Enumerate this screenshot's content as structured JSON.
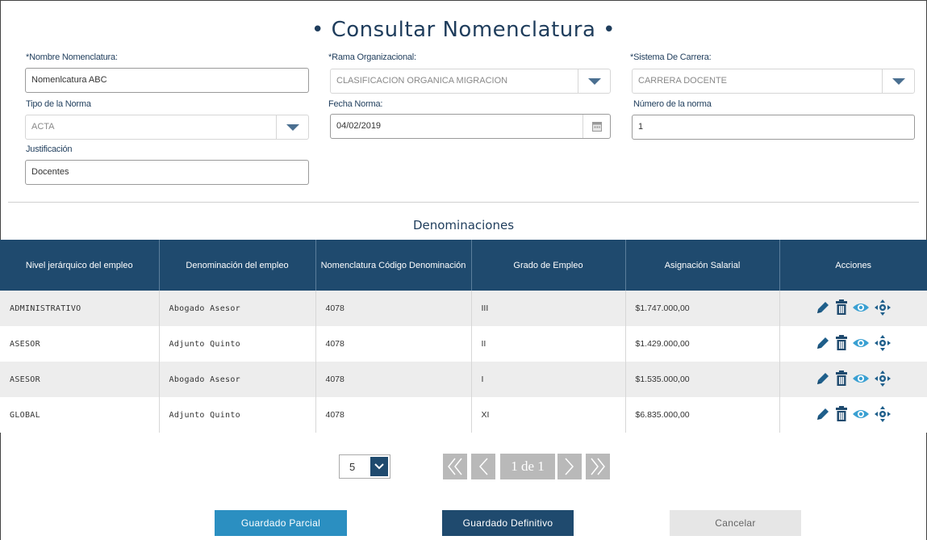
{
  "page": {
    "title": "• Consultar Nomenclatura •"
  },
  "form": {
    "nombre": {
      "label": "*Nombre Nomenclatura:",
      "value": "Nomenlcatura ABC"
    },
    "rama": {
      "label": "*Rama Organizacional:",
      "value": "CLASIFICACION ORGANICA MIGRACION"
    },
    "sistema": {
      "label": "*Sistema De Carrera:",
      "value": "CARRERA DOCENTE"
    },
    "tipo": {
      "label": "Tipo de la Norma",
      "value": "ACTA"
    },
    "fecha": {
      "label": "Fecha Norma:",
      "value": "04/02/2019"
    },
    "numero": {
      "label": "Número de la norma",
      "value": "1"
    },
    "justificacion": {
      "label": "Justificación",
      "value": "Docentes"
    }
  },
  "section": {
    "title": "Denominaciones"
  },
  "table": {
    "headers": [
      "Nivel jerárquico del empleo",
      "Denominación del empleo",
      "Nomenclatura Código Denominación",
      "Grado de Empleo",
      "Asignación Salarial",
      "Acciones"
    ],
    "rows": [
      {
        "nivel": "ADMINISTRATIVO",
        "denominacion": "Abogado Asesor",
        "codigo": "4078",
        "grado": "III",
        "salario": "$1.747.000,00"
      },
      {
        "nivel": "ASESOR",
        "denominacion": "Adjunto Quinto",
        "codigo": "4078",
        "grado": "II",
        "salario": "$1.429.000,00"
      },
      {
        "nivel": "ASESOR",
        "denominacion": "Abogado Asesor",
        "codigo": "4078",
        "grado": "I",
        "salario": "$1.535.000,00"
      },
      {
        "nivel": "GLOBAL",
        "denominacion": "Adjunto Quinto",
        "codigo": "4078",
        "grado": "XI",
        "salario": "$6.835.000,00"
      }
    ]
  },
  "pagination": {
    "page_size": "5",
    "page_info": "1 de 1"
  },
  "buttons": {
    "partial": "Guardado Parcial",
    "definitive": "Guardado Definitivo",
    "cancel": "Cancelar"
  },
  "colors": {
    "primary": "#1f4a6e",
    "accent": "#2b8fc1",
    "row_alt": "#ededed"
  }
}
